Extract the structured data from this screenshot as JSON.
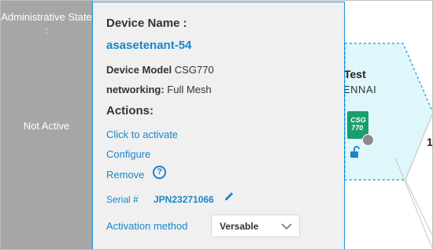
{
  "state": {
    "label": "Administrative State :",
    "value": "Not Active"
  },
  "panel": {
    "device_name_heading": "Device Name :",
    "device_name_value": "asasetenant-54",
    "device_model_key": "Device Model",
    "device_model_value": "CSG770",
    "networking_key": "networking:",
    "networking_value": "Full Mesh",
    "actions_heading": "Actions:",
    "actions": {
      "activate": "Click to activate",
      "configure": "Configure",
      "remove": "Remove"
    },
    "help_icon_glyph": "?",
    "serial_label": "Serial #",
    "serial_value": "JPN23271066",
    "activation_label": "Activation method",
    "activation_selected": "Versable"
  },
  "topology": {
    "node_title": "Test",
    "node_subtitle": "ENNAI",
    "device_icon_text": "CSG\n770",
    "edge_label": "1"
  },
  "colors": {
    "accent": "#1a86c9",
    "state_column": "#a6a6a6",
    "panel_bg": "#f0f0f0",
    "hex_fill": "#dff6fb",
    "device_icon": "#1b9e6e"
  },
  "icons": {
    "help": "question-circle-icon",
    "pencil": "pencil-icon",
    "chevron": "chevron-down-icon",
    "lock": "unlock-icon",
    "status": "status-dot-icon"
  }
}
